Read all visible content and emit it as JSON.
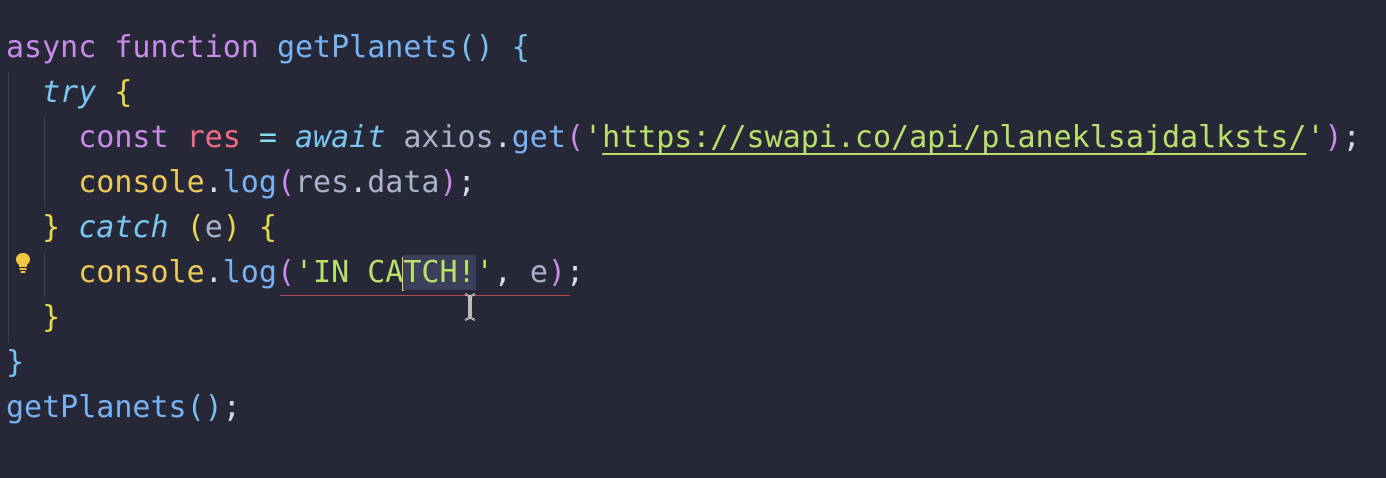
{
  "editor": {
    "lines": [
      {
        "tokens": [
          {
            "text": "async",
            "cls": "kw"
          },
          {
            "text": " ",
            "cls": "plain"
          },
          {
            "text": "function",
            "cls": "kw"
          },
          {
            "text": " ",
            "cls": "plain"
          },
          {
            "text": "getPlanets",
            "cls": "fn"
          },
          {
            "text": "()",
            "cls": "br3"
          },
          {
            "text": " ",
            "cls": "plain"
          },
          {
            "text": "{",
            "cls": "br3"
          }
        ]
      },
      {
        "tokens": [
          {
            "text": "  ",
            "cls": "plain"
          },
          {
            "text": "try",
            "cls": "kw-i"
          },
          {
            "text": " ",
            "cls": "plain"
          },
          {
            "text": "{",
            "cls": "br1"
          }
        ]
      },
      {
        "tokens": [
          {
            "text": "    ",
            "cls": "plain"
          },
          {
            "text": "const",
            "cls": "kw"
          },
          {
            "text": " ",
            "cls": "plain"
          },
          {
            "text": "res",
            "cls": "var"
          },
          {
            "text": " ",
            "cls": "plain"
          },
          {
            "text": "=",
            "cls": "op"
          },
          {
            "text": " ",
            "cls": "plain"
          },
          {
            "text": "await",
            "cls": "kw-i"
          },
          {
            "text": " ",
            "cls": "plain"
          },
          {
            "text": "axios",
            "cls": "prop"
          },
          {
            "text": ".",
            "cls": "plain"
          },
          {
            "text": "get",
            "cls": "fn"
          },
          {
            "text": "(",
            "cls": "br2"
          },
          {
            "text": "'",
            "cls": "str"
          },
          {
            "text": "https://swapi.co/api/planeklsajdalksts/",
            "cls": "str url"
          },
          {
            "text": "'",
            "cls": "str"
          },
          {
            "text": ")",
            "cls": "br2"
          },
          {
            "text": ";",
            "cls": "plain"
          }
        ]
      },
      {
        "tokens": [
          {
            "text": "    ",
            "cls": "plain"
          },
          {
            "text": "console",
            "cls": "obj"
          },
          {
            "text": ".",
            "cls": "plain"
          },
          {
            "text": "log",
            "cls": "fn"
          },
          {
            "text": "(",
            "cls": "br2"
          },
          {
            "text": "res",
            "cls": "prop"
          },
          {
            "text": ".",
            "cls": "plain"
          },
          {
            "text": "data",
            "cls": "prop"
          },
          {
            "text": ")",
            "cls": "br2"
          },
          {
            "text": ";",
            "cls": "plain"
          }
        ]
      },
      {
        "tokens": [
          {
            "text": "  ",
            "cls": "plain"
          },
          {
            "text": "}",
            "cls": "br1"
          },
          {
            "text": " ",
            "cls": "plain"
          },
          {
            "text": "catch",
            "cls": "kw-i"
          },
          {
            "text": " ",
            "cls": "plain"
          },
          {
            "text": "(",
            "cls": "br1"
          },
          {
            "text": "e",
            "cls": "prop"
          },
          {
            "text": ")",
            "cls": "br1"
          },
          {
            "text": " ",
            "cls": "plain"
          },
          {
            "text": "{",
            "cls": "br1"
          }
        ]
      },
      {
        "tokens": [
          {
            "text": "    ",
            "cls": "plain"
          },
          {
            "text": "console",
            "cls": "obj"
          },
          {
            "text": ".",
            "cls": "plain"
          },
          {
            "text": "log",
            "cls": "fn"
          },
          {
            "text": "(",
            "cls": "br2"
          },
          {
            "text": "'IN CA",
            "cls": "str"
          },
          {
            "text": "",
            "cls": "cursor"
          },
          {
            "text": "TCH!",
            "cls": "str sel"
          },
          {
            "text": "'",
            "cls": "str"
          },
          {
            "text": ",",
            "cls": "plain"
          },
          {
            "text": " ",
            "cls": "plain"
          },
          {
            "text": "e",
            "cls": "prop"
          },
          {
            "text": ")",
            "cls": "br2"
          },
          {
            "text": ";",
            "cls": "plain"
          }
        ]
      },
      {
        "tokens": [
          {
            "text": "  ",
            "cls": "plain"
          },
          {
            "text": "}",
            "cls": "br1"
          }
        ]
      },
      {
        "tokens": [
          {
            "text": "}",
            "cls": "br3"
          }
        ]
      },
      {
        "tokens": [
          {
            "text": "getPlanets",
            "cls": "fn"
          },
          {
            "text": "()",
            "cls": "br3"
          },
          {
            "text": ";",
            "cls": "plain"
          }
        ]
      }
    ]
  },
  "icons": {
    "lightbulb": "lightbulb-icon",
    "text_cursor": "text-cursor-icon"
  },
  "colors": {
    "background": "#262837",
    "cursor": "#f0d24a",
    "lightbulb": "#f2c744"
  }
}
